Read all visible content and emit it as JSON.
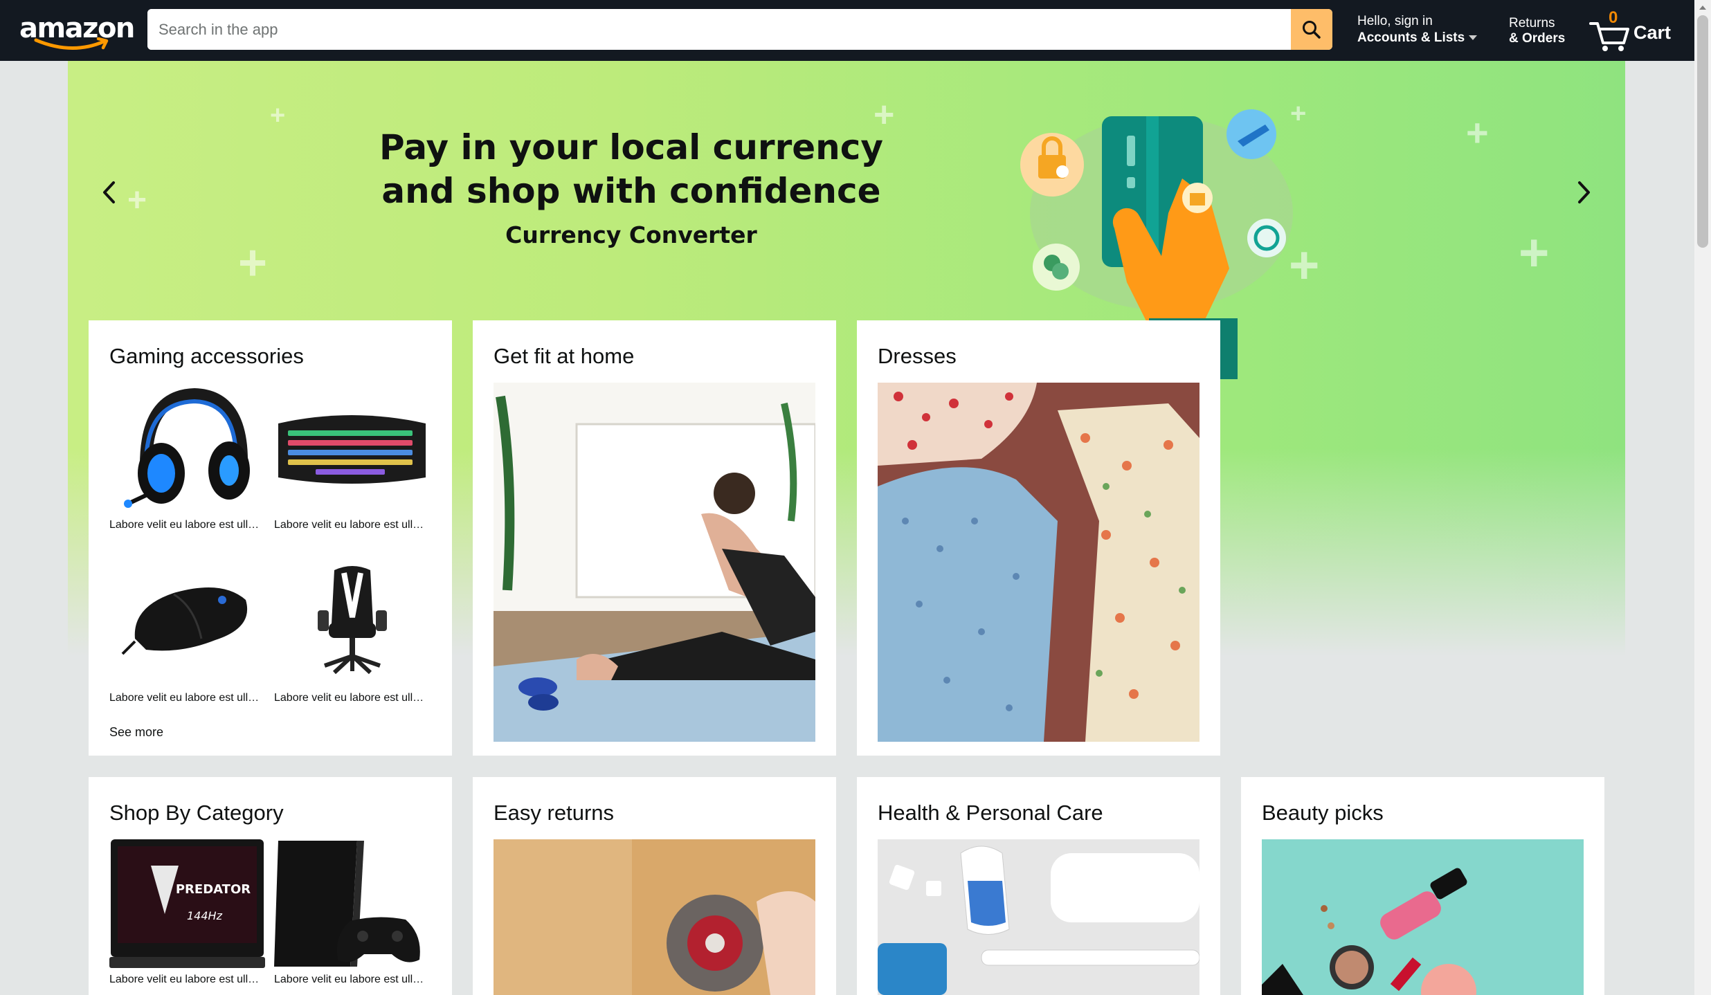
{
  "header": {
    "logo_text": "amazon",
    "search_placeholder": "Search in the app",
    "account_line1": "Hello, sign in",
    "account_line2": "Accounts & Lists",
    "returns_line1": "Returns",
    "returns_line2": "& Orders",
    "cart_count": "0",
    "cart_label": "Cart"
  },
  "hero": {
    "title_line1": "Pay in your local currency",
    "title_line2": "and shop with confidence",
    "subtitle": "Currency Converter"
  },
  "cards": {
    "gaming": {
      "title": "Gaming accessories",
      "items": [
        {
          "caption": "Labore velit eu labore est ullamco",
          "icon": "headset"
        },
        {
          "caption": "Labore velit eu labore est ullamco",
          "icon": "keyboard"
        },
        {
          "caption": "Labore velit eu labore est ullamco",
          "icon": "mouse"
        },
        {
          "caption": "Labore velit eu labore est ullamco",
          "icon": "chair"
        }
      ],
      "see_more": "See more"
    },
    "fit": {
      "title": "Get fit at home"
    },
    "dresses": {
      "title": "Dresses"
    },
    "category": {
      "title": "Shop By Category",
      "items": [
        {
          "caption": "Labore velit eu labore est ullamco",
          "icon": "laptop",
          "screen_brand": "PREDATOR",
          "screen_text": "144Hz"
        },
        {
          "caption": "Labore velit eu labore est ullamco",
          "icon": "game-console"
        }
      ]
    },
    "returns": {
      "title": "Easy returns"
    },
    "health": {
      "title": "Health & Personal Care"
    },
    "beauty": {
      "title": "Beauty picks"
    }
  },
  "colors": {
    "header_bg": "#131921",
    "search_button": "#febd69",
    "cart_count": "#f08804",
    "hero_green": "#bdeb7b",
    "page_bg": "#e3e6e6"
  }
}
